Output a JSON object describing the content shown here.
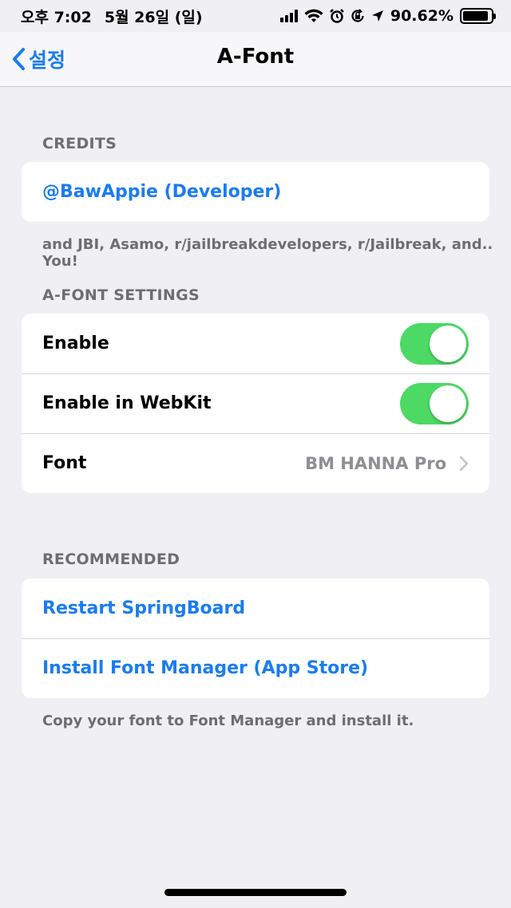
{
  "status_bar": {
    "time": "오후 7:02",
    "date": "5월 26일 (일)",
    "battery_percent": "90.62%",
    "battery_level": 0.9062,
    "icons": [
      "cellular-signal-icon",
      "wifi-icon",
      "alarm-icon",
      "orientation-lock-icon",
      "location-arrow-icon",
      "battery-icon"
    ]
  },
  "nav": {
    "back_label": "설정",
    "title": "A-Font"
  },
  "credits": {
    "header": "CREDITS",
    "developer_link": "@BawAppie (Developer)",
    "footer": "and JBI, Asamo, r/jailbreakdevelopers, r/Jailbreak, and.. You!"
  },
  "settings": {
    "header": "A-FONT SETTINGS",
    "enable_label": "Enable",
    "enable_on": true,
    "webkit_label": "Enable in WebKit",
    "webkit_on": true,
    "font_label": "Font",
    "font_value": "BM HANNA Pro"
  },
  "recommended": {
    "header": "RECOMMENDED",
    "restart_label": "Restart SpringBoard",
    "install_label": "Install Font Manager (App Store)",
    "footer": "Copy your font to Font Manager and install it."
  },
  "colors": {
    "accent": "#1a7cf0",
    "switch_on": "#4cd964",
    "background": "#efeff4"
  }
}
